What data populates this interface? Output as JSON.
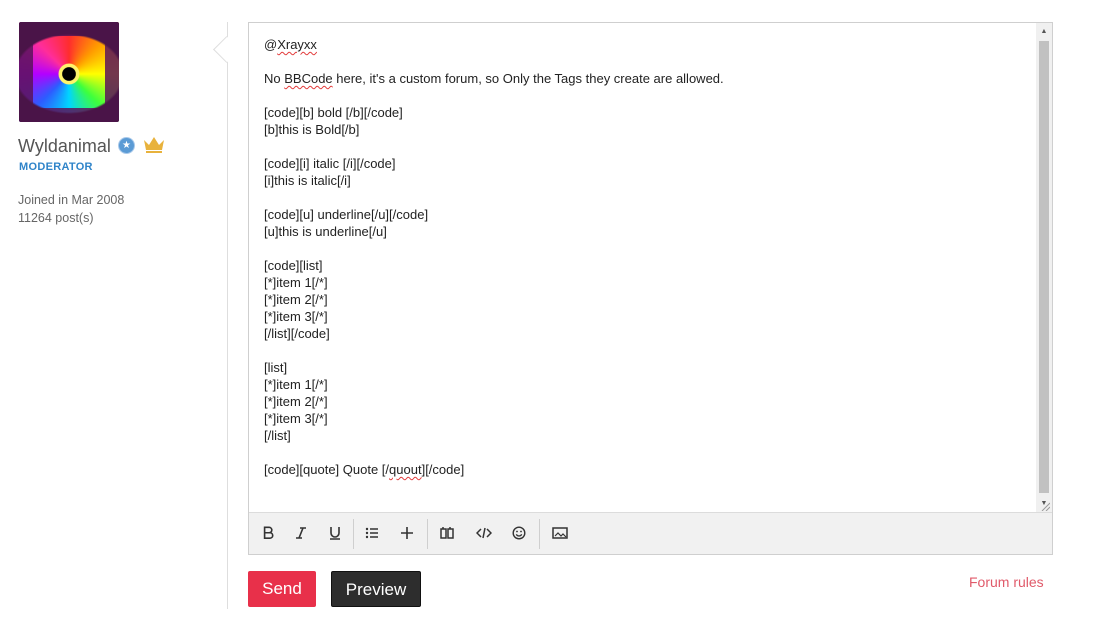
{
  "user": {
    "name": "Wyldanimal",
    "role": "MODERATOR",
    "joined": "Joined in Mar 2008",
    "posts": "11264 post(s)",
    "badge_icon": "verified-star-icon",
    "rank_icon": "crown-icon"
  },
  "editor": {
    "lines": [
      [
        "@",
        {
          "t": "Xrayxx",
          "sq": true
        }
      ],
      [
        ""
      ],
      [
        "No ",
        {
          "t": "BBCode",
          "sq": true
        },
        " here, it's a custom forum, so Only the Tags they create are allowed."
      ],
      [
        ""
      ],
      [
        "[code][b] bold [/b][/code]"
      ],
      [
        "[b]this is Bold[/b]"
      ],
      [
        ""
      ],
      [
        "[code][i] italic [/i][/code]"
      ],
      [
        "[i]this is italic[/i]"
      ],
      [
        ""
      ],
      [
        "[code][u] underline[/u][/code]"
      ],
      [
        "[u]this is underline[/u]"
      ],
      [
        ""
      ],
      [
        "[code][list]"
      ],
      [
        "[*]item 1[/*]"
      ],
      [
        "[*]item 2[/*]"
      ],
      [
        "[*]item 3[/*]"
      ],
      [
        "[/list][/code]"
      ],
      [
        ""
      ],
      [
        "[list]"
      ],
      [
        "[*]item 1[/*]"
      ],
      [
        "[*]item 2[/*]"
      ],
      [
        "[*]item 3[/*]"
      ],
      [
        "[/list]"
      ],
      [
        ""
      ],
      [
        "[code][quote] Quote [/",
        {
          "t": "quout",
          "sq": true
        },
        "][/code]"
      ]
    ]
  },
  "toolbar": {
    "buttons": [
      "bold",
      "italic",
      "underline",
      "bulleted-list",
      "add",
      "quote",
      "code",
      "emoji",
      "image"
    ]
  },
  "actions": {
    "send": "Send",
    "preview": "Preview",
    "forum_rules": "Forum rules"
  },
  "colors": {
    "send": "#e8304a",
    "preview": "#2d2d2d",
    "link": "#e05a6a",
    "role": "#2f84c9"
  }
}
